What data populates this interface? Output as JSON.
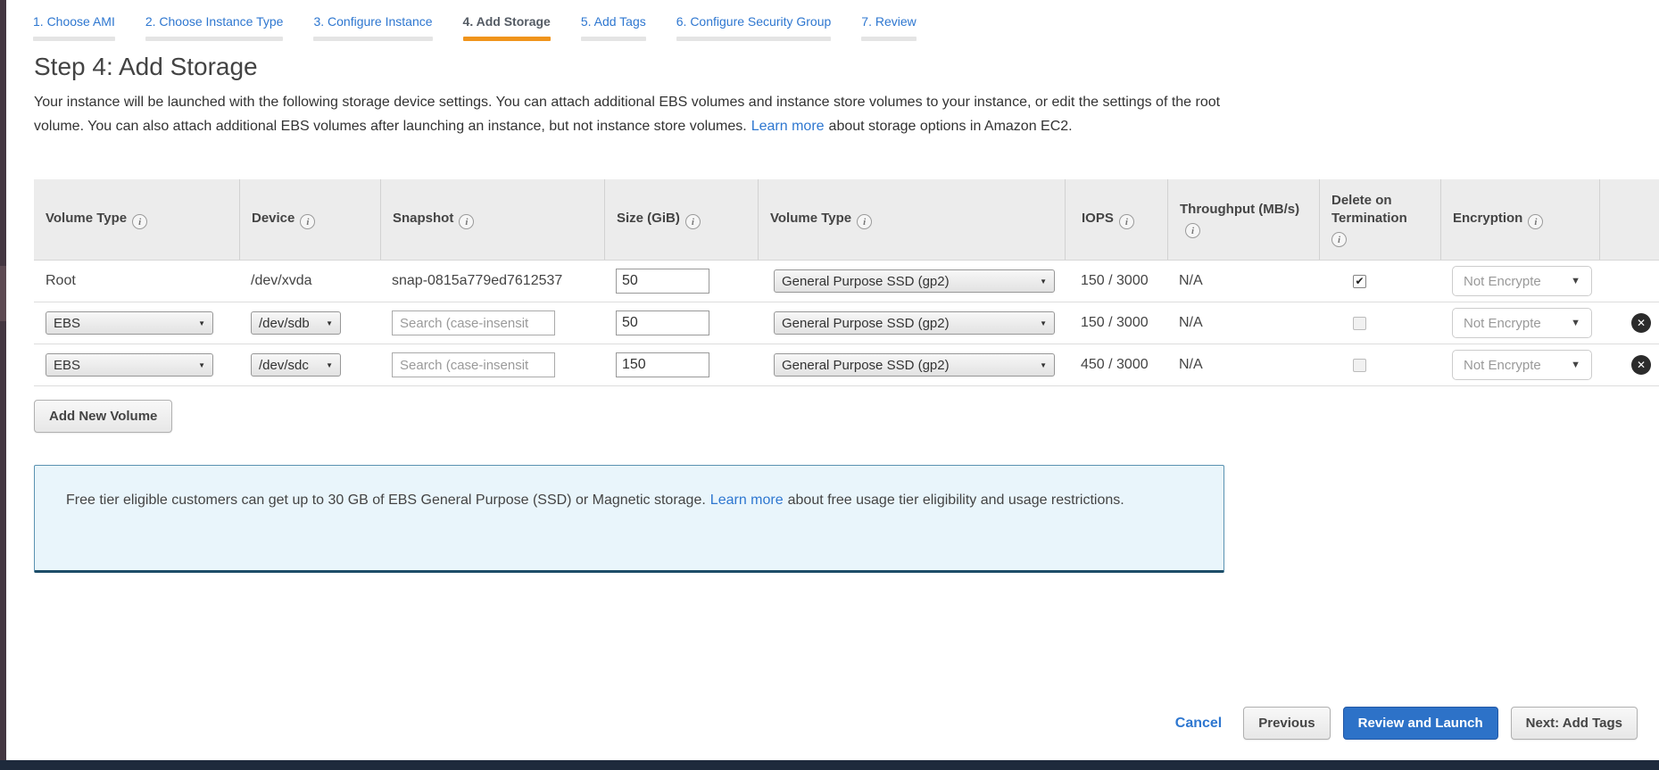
{
  "wizard_tabs": [
    {
      "label": "1. Choose AMI",
      "active": false
    },
    {
      "label": "2. Choose Instance Type",
      "active": false
    },
    {
      "label": "3. Configure Instance",
      "active": false
    },
    {
      "label": "4. Add Storage",
      "active": true
    },
    {
      "label": "5. Add Tags",
      "active": false
    },
    {
      "label": "6. Configure Security Group",
      "active": false
    },
    {
      "label": "7. Review",
      "active": false
    }
  ],
  "header": {
    "title": "Step 4: Add Storage",
    "intro_before_link": "Your instance will be launched with the following storage device settings. You can attach additional EBS volumes and instance store volumes to your instance, or edit the settings of the root volume. You can also attach additional EBS volumes after launching an instance, but not instance store volumes.",
    "intro_link": "Learn more",
    "intro_after_link": "about storage options in Amazon EC2."
  },
  "storage_table": {
    "columns": [
      {
        "label": "Volume Type",
        "info_icon": true,
        "icon_newline": false
      },
      {
        "label": "Device",
        "info_icon": true,
        "icon_newline": false
      },
      {
        "label": "Snapshot",
        "info_icon": true,
        "icon_newline": false
      },
      {
        "label": "Size (GiB)",
        "info_icon": true,
        "icon_newline": false
      },
      {
        "label": "Volume Type",
        "info_icon": true,
        "icon_newline": false
      },
      {
        "label": "IOPS",
        "info_icon": true,
        "icon_newline": false
      },
      {
        "label": "Throughput (MB/s)",
        "info_icon": true,
        "icon_newline": false
      },
      {
        "label": "Delete on Termination",
        "info_icon": true,
        "icon_newline": true
      },
      {
        "label": "Encryption",
        "info_icon": true,
        "icon_newline": false
      },
      {
        "label": "",
        "info_icon": false,
        "icon_newline": false
      }
    ],
    "rows": [
      {
        "volume_type": {
          "kind": "text",
          "value": "Root"
        },
        "device": {
          "kind": "text",
          "value": "/dev/xvda"
        },
        "snapshot": {
          "kind": "text",
          "value": "snap-0815a779ed7612537"
        },
        "size": {
          "value": "50"
        },
        "volume_type_select": "General Purpose SSD (gp2)",
        "iops": "150 / 3000",
        "throughput": "N/A",
        "delete_on_termination": true,
        "encryption": "Not Encrypte",
        "deletable": false
      },
      {
        "volume_type": {
          "kind": "select",
          "value": "EBS"
        },
        "device": {
          "kind": "select",
          "value": "/dev/sdb"
        },
        "snapshot": {
          "kind": "search",
          "placeholder": "Search (case-insensit"
        },
        "size": {
          "value": "50"
        },
        "volume_type_select": "General Purpose SSD (gp2)",
        "iops": "150 / 3000",
        "throughput": "N/A",
        "delete_on_termination": false,
        "encryption": "Not Encrypte",
        "deletable": true
      },
      {
        "volume_type": {
          "kind": "select",
          "value": "EBS"
        },
        "device": {
          "kind": "select",
          "value": "/dev/sdc"
        },
        "snapshot": {
          "kind": "search",
          "placeholder": "Search (case-insensit"
        },
        "size": {
          "value": "150"
        },
        "volume_type_select": "General Purpose SSD (gp2)",
        "iops": "450 / 3000",
        "throughput": "N/A",
        "delete_on_termination": false,
        "encryption": "Not Encrypte",
        "deletable": true
      }
    ]
  },
  "actions": {
    "add_new_volume": "Add New Volume"
  },
  "free_tier_notice": {
    "before_link": "Free tier eligible customers can get up to 30 GB of EBS General Purpose (SSD) or Magnetic storage.",
    "link": "Learn more",
    "after_link": "about free usage tier eligibility and usage restrictions."
  },
  "footer": {
    "cancel": "Cancel",
    "previous": "Previous",
    "review_and_launch": "Review and Launch",
    "next": "Next: Add Tags"
  },
  "icons": {
    "info": "i",
    "select_arrow": "▼",
    "dropdown_arrow": "▼",
    "check": "✔",
    "delete_x": "✕"
  },
  "colors": {
    "accent_orange": "#f0941c",
    "link_blue": "#2e77d0",
    "primary_button_blue": "#2d72c8",
    "notice_bg": "#e9f5fb",
    "notice_border": "#5a92b1",
    "left_strip": "#443741",
    "bottom_bar": "#1e2a3c"
  }
}
